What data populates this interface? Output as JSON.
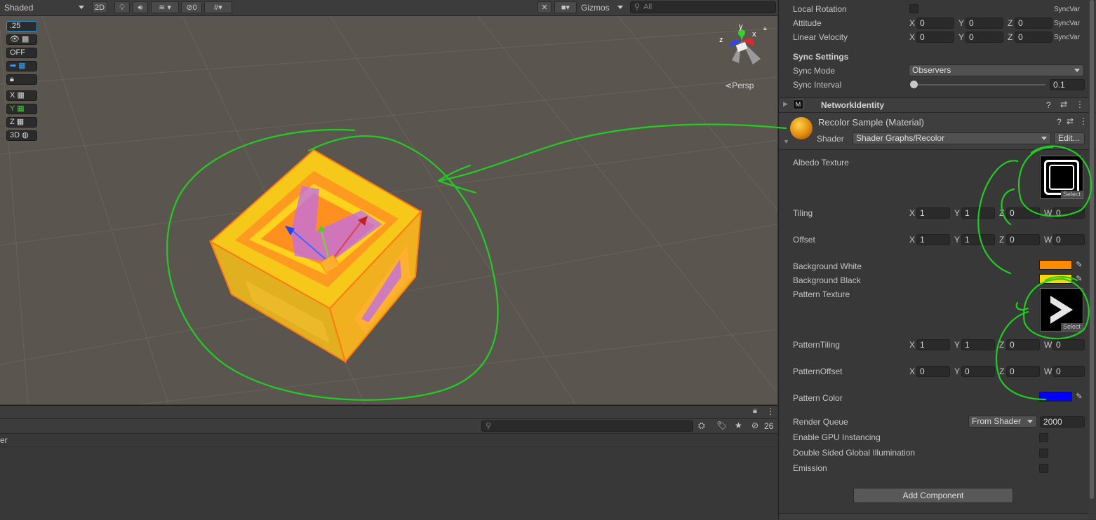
{
  "scene": {
    "toolbar": {
      "shading_mode": "Shaded",
      "mode_2d": "2D",
      "hidden_count": "0",
      "gizmos_label": "Gizmos",
      "search_placeholder": "All"
    },
    "overlay": {
      "grid_size": ".25",
      "off_label": "OFF",
      "x_label": "X",
      "y_label": "Y",
      "z_label": "Z",
      "label_3d": "3D"
    },
    "gizmo_axes": {
      "x": "x",
      "y": "y",
      "z": "z"
    },
    "persp_label": "Persp"
  },
  "bottom_panel": {
    "hidden_count": "26",
    "row_text": "er"
  },
  "inspector": {
    "transform_rows": [
      {
        "label": "Local Rotation",
        "type": "checkbox",
        "sync": "SyncVar"
      },
      {
        "label": "Attitude",
        "x": "0",
        "y": "0",
        "z": "0",
        "sync": "SyncVar"
      },
      {
        "label": "Linear Velocity",
        "x": "0",
        "y": "0",
        "z": "0",
        "sync": "SyncVar"
      }
    ],
    "sync_settings": {
      "header": "Sync Settings",
      "mode_label": "Sync Mode",
      "mode_value": "Observers",
      "interval_label": "Sync Interval",
      "interval_value": "0.1",
      "interval_fraction": 0.0
    },
    "network_identity": {
      "title": "NetworkIdentity"
    },
    "material": {
      "title": "Recolor Sample (Material)",
      "shader_label": "Shader",
      "shader_value": "Shader Graphs/Recolor",
      "edit_label": "Edit...",
      "albedo_label": "Albedo Texture",
      "select_label": "Select",
      "tiling_label": "Tiling",
      "tiling": {
        "x": "1",
        "y": "1",
        "z": "0",
        "w": "0"
      },
      "offset_label": "Offset",
      "offset": {
        "x": "1",
        "y": "1",
        "z": "0",
        "w": "0"
      },
      "bg_white_label": "Background White",
      "bg_white_color": "#ff8c00",
      "bg_black_label": "Background Black",
      "bg_black_color": "#ffd800",
      "pattern_texture_label": "Pattern Texture",
      "pattern_tiling_label": "PatternTiling",
      "pattern_tiling": {
        "x": "1",
        "y": "1",
        "z": "0",
        "w": "0"
      },
      "pattern_offset_label": "PatternOffset",
      "pattern_offset": {
        "x": "0",
        "y": "0",
        "z": "0",
        "w": "0"
      },
      "pattern_color_label": "Pattern Color",
      "pattern_color": "#0000ff",
      "render_queue_label": "Render Queue",
      "render_queue_mode": "From Shader",
      "render_queue_value": "2000",
      "gpu_instancing_label": "Enable GPU Instancing",
      "double_sided_gi_label": "Double Sided Global Illumination",
      "emission_label": "Emission"
    },
    "add_component": "Add Component"
  },
  "axis_labels": {
    "x": "X",
    "y": "Y",
    "z": "Z",
    "w": "W"
  },
  "colors": {
    "annotation": "#22cc22",
    "scene_bg": "#5b5550",
    "panel_bg": "#383838"
  }
}
